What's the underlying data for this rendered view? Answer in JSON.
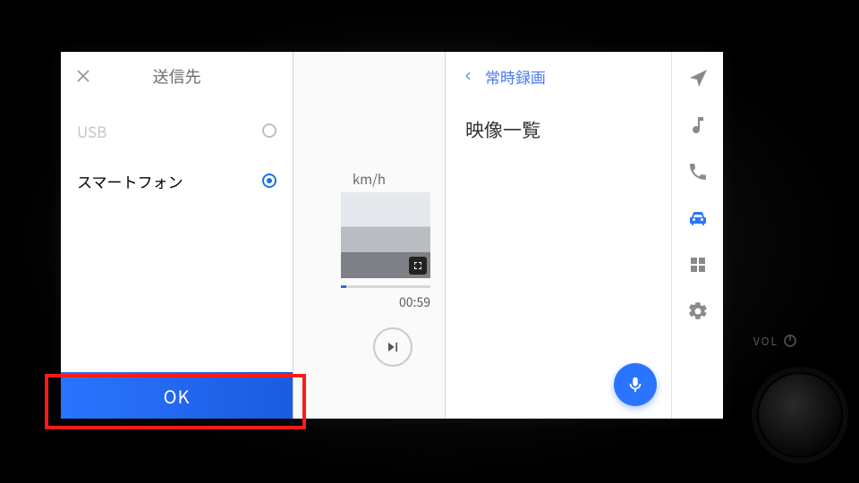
{
  "panel": {
    "title": "送信先",
    "options": [
      {
        "label": "USB",
        "selected": false,
        "disabled": true
      },
      {
        "label": "スマートフォン",
        "selected": true,
        "disabled": false
      }
    ],
    "ok_label": "OK"
  },
  "playback": {
    "speed_unit": "km/h",
    "duration": "00:59"
  },
  "list": {
    "back_label": "常時録画",
    "section_title": "映像一覧"
  },
  "rail": {
    "items": [
      "navigation",
      "music",
      "phone",
      "car",
      "apps",
      "settings"
    ],
    "active": "car"
  },
  "bezel": {
    "vol_label": "VOL"
  }
}
